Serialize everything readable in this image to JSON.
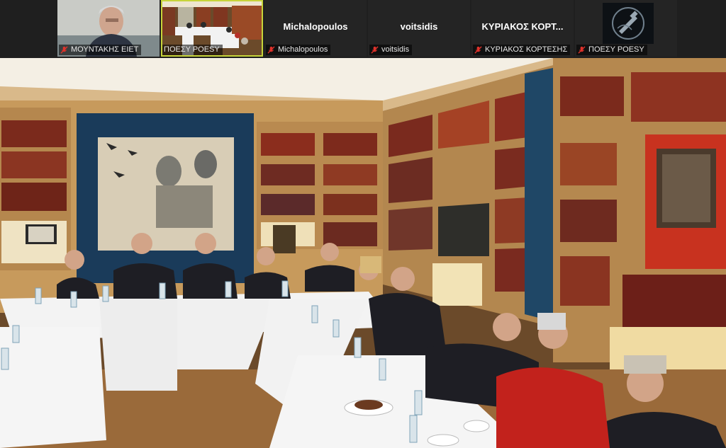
{
  "participants": [
    {
      "name_display": "",
      "label": "ΜΟΥΝΤΑΚΗΣ ΕΙΕΤ",
      "has_video": true,
      "muted": true
    },
    {
      "name_display": "",
      "label": "ΠΟΕΣΥ POESY",
      "has_video": true,
      "muted": false,
      "active_speaker": true
    },
    {
      "name_display": "Michalopoulos",
      "label": "Michalopoulos",
      "has_video": false,
      "muted": true
    },
    {
      "name_display": "voitsidis",
      "label": "voitsidis",
      "has_video": false,
      "muted": true
    },
    {
      "name_display": "ΚΥΡΙΑΚΟΣ ΚΟΡΤ...",
      "label": "ΚΥΡΙΑΚΟΣ ΚΟΡΤΕΣΗΣ",
      "has_video": false,
      "muted": true
    },
    {
      "name_display": "",
      "label": "ΠΟΕΣΥ POESY",
      "has_video": false,
      "has_avatar": true,
      "muted": true
    }
  ],
  "colors": {
    "active_outline": "#c7d43a",
    "muted_mic": "#e0322b",
    "strip_bg": "#1f1f1f"
  },
  "icons": {
    "muted": "mic-muted-icon",
    "avatar": "poesy-logo-icon"
  }
}
